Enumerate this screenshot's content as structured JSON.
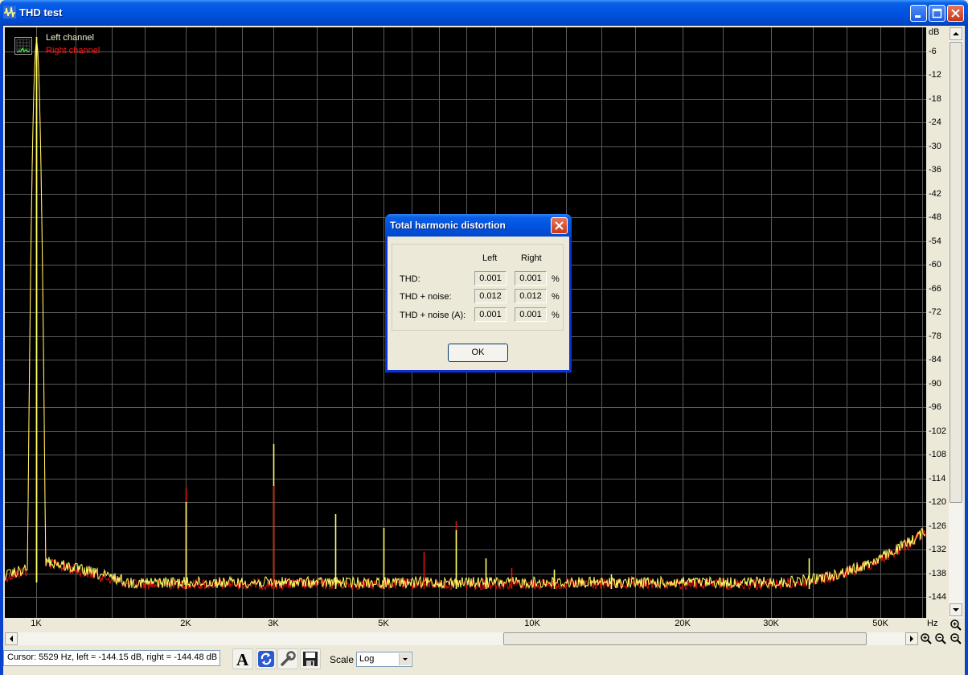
{
  "window": {
    "title": "THD test"
  },
  "legend": {
    "left_channel": "Left channel",
    "right_channel": "Right channel"
  },
  "y_axis": {
    "unit": "dB",
    "labels": [
      "-6",
      "-12",
      "-18",
      "-24",
      "-30",
      "-36",
      "-42",
      "-48",
      "-54",
      "-60",
      "-66",
      "-72",
      "-78",
      "-84",
      "-90",
      "-96",
      "-102",
      "-108",
      "-114",
      "-120",
      "-126",
      "-132",
      "-138",
      "-144"
    ]
  },
  "x_axis": {
    "unit": "Hz",
    "labels": [
      "1K",
      "2K",
      "3K",
      "5K",
      "10K",
      "20K",
      "30K",
      "50K"
    ]
  },
  "status": {
    "cursor": "Cursor:  5529 Hz,  left = -144.15 dB,  right = -144.48 dB"
  },
  "toolbar": {
    "scale_label": "Scale",
    "scale_value": "Log"
  },
  "dialog": {
    "title": "Total harmonic distortion",
    "col_left": "Left",
    "col_right": "Right",
    "rows": [
      {
        "label": "THD:",
        "left": "0.001",
        "right": "0.001",
        "unit": "%"
      },
      {
        "label": "THD + noise:",
        "left": "0.012",
        "right": "0.012",
        "unit": "%"
      },
      {
        "label": "THD + noise (A):",
        "left": "0.001",
        "right": "0.001",
        "unit": "%"
      }
    ],
    "ok_label": "OK"
  },
  "colors": {
    "left_trace": "#FFFF66",
    "right_trace": "#E01010",
    "grid": "#5A5A5A"
  }
}
